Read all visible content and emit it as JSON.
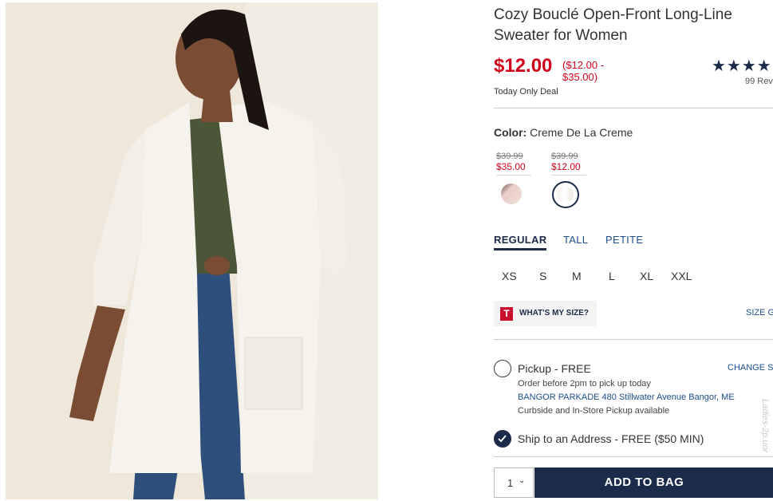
{
  "product": {
    "title": "Cozy Bouclé Open-Front Long-Line Sweater for Women",
    "price": "$12.00",
    "price_range": "($12.00 - $35.00)",
    "deal": "Today Only Deal",
    "rating_stars": "★★★★",
    "reviews": "99 Rev"
  },
  "color": {
    "label": "Color:",
    "value": "Creme De La Creme",
    "swatches": [
      {
        "orig": "$39.99",
        "sale": "$35.00",
        "name": "blush"
      },
      {
        "orig": "$39.99",
        "sale": "$12.00",
        "name": "creme"
      }
    ]
  },
  "fit_tabs": [
    "REGULAR",
    "TALL",
    "PETITE"
  ],
  "sizes": [
    "XS",
    "S",
    "M",
    "L",
    "XL",
    "XXL"
  ],
  "size_help": {
    "badge": "T",
    "label": "WHAT'S MY SIZE?",
    "guide": "SIZE G"
  },
  "pickup": {
    "label": "Pickup - FREE",
    "note": "Order before 2pm to pick up today",
    "store": "BANGOR PARKADE 480 Stillwater Avenue  Bangor, ME",
    "curbside": "Curbside and In-Store Pickup available",
    "change": "CHANGE S"
  },
  "ship": {
    "label": "Ship to an Address - FREE ($50 MIN)"
  },
  "cart": {
    "qty": "1",
    "add_label": "ADD TO BAG"
  },
  "watermark": "Ladies-2p.uor",
  "colors": {
    "sale_red": "#d0021b",
    "navy": "#1c2b4a",
    "link_blue": "#1c4f8c"
  }
}
